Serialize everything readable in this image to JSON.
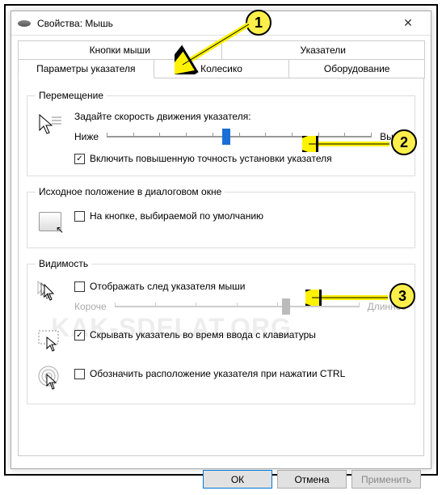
{
  "window": {
    "title": "Свойства: Мышь"
  },
  "tabs": {
    "row1": [
      "Кнопки мыши",
      "Указатели"
    ],
    "row2": [
      "Параметры указателя",
      "Колесико",
      "Оборудование"
    ],
    "active": "Параметры указателя"
  },
  "motion": {
    "legend": "Перемещение",
    "speed_label": "Задайте скорость движения указателя:",
    "low": "Ниже",
    "high": "Выше",
    "enhance": {
      "checked": true,
      "label": "Включить повышенную точность установки указателя"
    }
  },
  "snap": {
    "legend": "Исходное положение в диалоговом окне",
    "opt": {
      "checked": false,
      "label": "На кнопке, выбираемой по умолчанию"
    }
  },
  "visibility": {
    "legend": "Видимость",
    "trails": {
      "checked": false,
      "label": "Отображать след указателя мыши"
    },
    "trail_low": "Короче",
    "trail_high": "Длиннее",
    "hide": {
      "checked": true,
      "label": "Скрывать указатель во время ввода с клавиатуры"
    },
    "ctrl": {
      "checked": false,
      "label": "Обозначить расположение указателя при нажатии CTRL"
    }
  },
  "buttons": {
    "ok": "ОК",
    "cancel": "Отмена",
    "apply": "Применить"
  },
  "watermark": "KAK-SDELAT.ORG",
  "markers": {
    "m1": "1",
    "m2": "2",
    "m3": "3"
  }
}
